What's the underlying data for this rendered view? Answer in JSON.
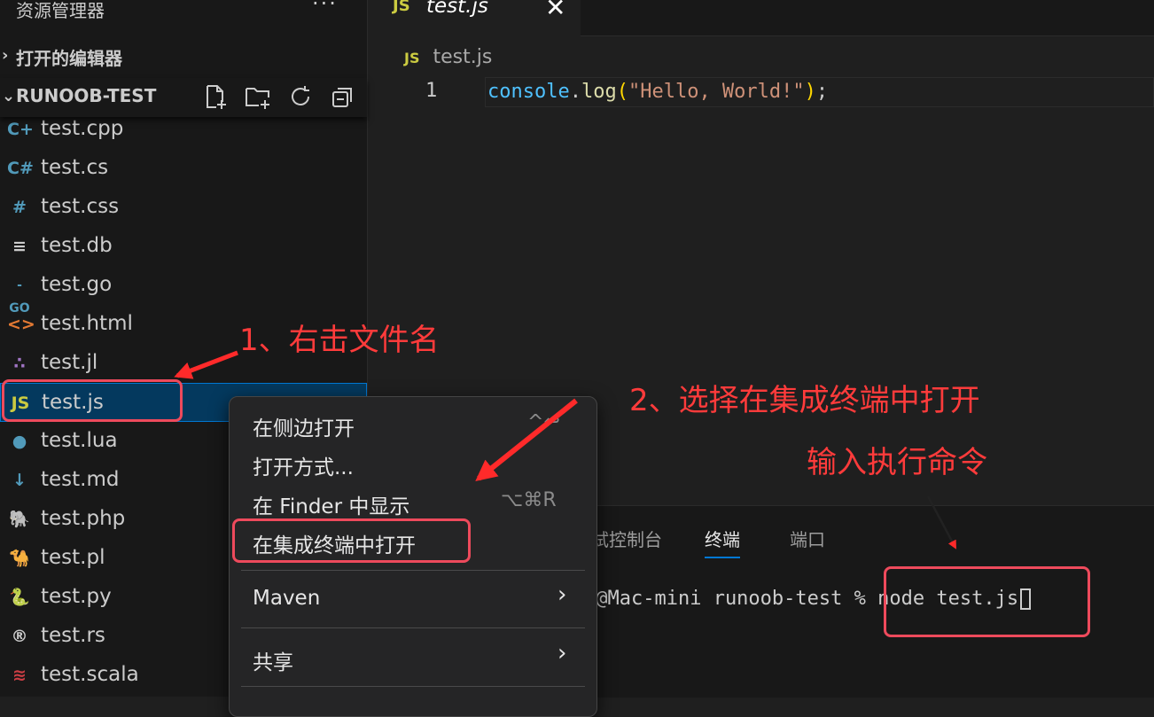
{
  "sidebar": {
    "title": "资源管理器",
    "more": "···",
    "open_editors": "打开的编辑器",
    "project_name": "RUNOOB-TEST",
    "files": [
      {
        "name": "test.cpp",
        "icon": "C+",
        "color": "#519aba"
      },
      {
        "name": "test.cs",
        "icon": "C#",
        "color": "#519aba"
      },
      {
        "name": "test.css",
        "icon": "#",
        "color": "#519aba"
      },
      {
        "name": "test.db",
        "icon": "≡",
        "color": "#cccccc"
      },
      {
        "name": "test.go",
        "icon": "-GO",
        "color": "#519aba"
      },
      {
        "name": "test.html",
        "icon": "<>",
        "color": "#e37933"
      },
      {
        "name": "test.jl",
        "icon": "∴",
        "color": "#a074c4"
      },
      {
        "name": "test.js",
        "icon": "JS",
        "color": "#cbcb41"
      },
      {
        "name": "test.lua",
        "icon": "●",
        "color": "#519aba"
      },
      {
        "name": "test.md",
        "icon": "↓",
        "color": "#519aba"
      },
      {
        "name": "test.php",
        "icon": "🐘",
        "color": "#a074c4"
      },
      {
        "name": "test.pl",
        "icon": "🐪",
        "color": "#519aba"
      },
      {
        "name": "test.py",
        "icon": "🐍",
        "color": "#519aba"
      },
      {
        "name": "test.rs",
        "icon": "®",
        "color": "#cccccc"
      },
      {
        "name": "test.scala",
        "icon": "≋",
        "color": "#cc3e44"
      }
    ]
  },
  "editor": {
    "tab_badge": "JS",
    "tab_name": "test.js",
    "tab_close": "✕",
    "breadcrumb": "test.js",
    "line_number": "1",
    "code": {
      "obj": "console",
      "dot": ".",
      "fn": "log",
      "open": "(",
      "str": "\"Hello, World!\"",
      "close": ")",
      "semi": ";"
    }
  },
  "panel": {
    "tabs": [
      "试控制台",
      "终端",
      "端口"
    ],
    "terminal_prompt": "n@Mac-mini runoob-test % ",
    "terminal_command": "node test.js"
  },
  "context_menu": {
    "items": [
      {
        "label": "在侧边打开",
        "shortcut": "^↩"
      },
      {
        "label": "打开方式...",
        "shortcut": ""
      },
      {
        "label": "在 Finder 中显示",
        "shortcut": "⌥⌘R"
      },
      {
        "label": "在集成终端中打开",
        "shortcut": ""
      },
      {
        "label": "Maven",
        "shortcut": ""
      },
      {
        "label": "共享",
        "shortcut": ""
      }
    ],
    "submenu_arrow": "›"
  },
  "annotations": {
    "step1": "1、右击文件名",
    "step2": "2、选择在集成终端中打开",
    "step3": "输入执行命令"
  },
  "colors": {
    "annotation_red": "#ff3b3b",
    "selection_blue": "#04395e",
    "accent_blue": "#0078d4"
  }
}
